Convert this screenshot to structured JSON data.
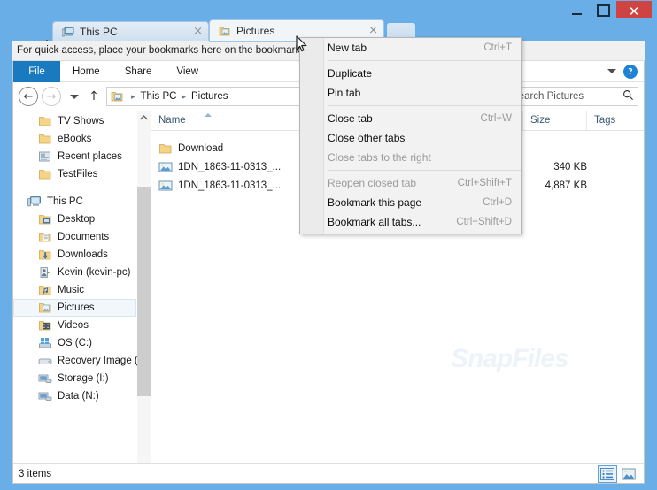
{
  "window": {
    "controls": {
      "minimize": "–",
      "maximize": "☐",
      "close": "✕"
    },
    "close_color": "#cf4343",
    "frame_color": "#6aaee8"
  },
  "tabs": {
    "items": [
      {
        "label": "This PC",
        "icon": "this-pc-icon",
        "close": "×",
        "active": false
      },
      {
        "label": "Pictures",
        "icon": "pictures-folder-icon",
        "close": "×",
        "active": true
      }
    ],
    "new_tab_button": "",
    "wrench_icon": "wrench-icon"
  },
  "bookmark_bar": {
    "text": "For quick access, place your bookmarks here on the bookmarks bar."
  },
  "ribbon": {
    "tabs": [
      {
        "label": "File",
        "accent": "#1a7ac0"
      },
      {
        "label": "Home"
      },
      {
        "label": "Share"
      },
      {
        "label": "View"
      }
    ],
    "expand_icon": "chevron-down-icon",
    "help_label": "?"
  },
  "address_bar": {
    "back": "←",
    "forward": "→",
    "history": "▼",
    "up": "↑",
    "folder_icon": "pictures-folder-icon",
    "crumbs": [
      "This PC",
      "Pictures"
    ],
    "separator": "▸"
  },
  "search": {
    "value": "Search Pictures",
    "placeholder": "Search Pictures",
    "icon": "search-icon"
  },
  "nav_pane": {
    "items": [
      {
        "label": "TV Shows",
        "icon": "folder-icon",
        "level": 1
      },
      {
        "label": "eBooks",
        "icon": "folder-icon",
        "level": 1
      },
      {
        "label": "Recent places",
        "icon": "recent-places-icon",
        "level": 1
      },
      {
        "label": "TestFiles",
        "icon": "folder-icon",
        "level": 1
      },
      {
        "label": "",
        "icon": "",
        "level": -1
      },
      {
        "label": "This PC",
        "icon": "this-pc-icon",
        "level": 0
      },
      {
        "label": "Desktop",
        "icon": "desktop-folder-icon",
        "level": 1
      },
      {
        "label": "Documents",
        "icon": "documents-folder-icon",
        "level": 1
      },
      {
        "label": "Downloads",
        "icon": "downloads-folder-icon",
        "level": 1
      },
      {
        "label": "Kevin (kevin-pc)",
        "icon": "user-folder-icon",
        "level": 1
      },
      {
        "label": "Music",
        "icon": "music-folder-icon",
        "level": 1
      },
      {
        "label": "Pictures",
        "icon": "pictures-folder-icon",
        "level": 1,
        "selected": true
      },
      {
        "label": "Videos",
        "icon": "videos-folder-icon",
        "level": 1
      },
      {
        "label": "OS (C:)",
        "icon": "os-drive-icon",
        "level": 1
      },
      {
        "label": "Recovery Image (",
        "icon": "drive-icon",
        "level": 1
      },
      {
        "label": "Storage (I:)",
        "icon": "network-drive-icon",
        "level": 1
      },
      {
        "label": "Data (N:)",
        "icon": "network-drive-icon",
        "level": 1
      }
    ],
    "scroll_up": "ⱏ",
    "scroll_down": "ⱟ"
  },
  "file_list": {
    "columns": [
      {
        "label": "Name",
        "sorted": true
      },
      {
        "label": "Size"
      },
      {
        "label": "Tags"
      }
    ],
    "rows": [
      {
        "name": "Download",
        "icon": "folder-icon",
        "size": ""
      },
      {
        "name": "1DN_1863-11-0313_...",
        "icon": "image-file-icon",
        "size": "340 KB"
      },
      {
        "name": "1DN_1863-11-0313_...",
        "icon": "image-file-icon",
        "size": "4,887 KB"
      }
    ],
    "hscroll_left": "‹",
    "hscroll_right": "›"
  },
  "context_menu": {
    "items": [
      {
        "label": "New tab",
        "accel": "Ctrl+T",
        "disabled": false
      },
      {
        "sep": true
      },
      {
        "label": "Duplicate",
        "accel": "",
        "disabled": false
      },
      {
        "label": "Pin tab",
        "accel": "",
        "disabled": false
      },
      {
        "sep": true
      },
      {
        "label": "Close tab",
        "accel": "Ctrl+W",
        "disabled": false
      },
      {
        "label": "Close other tabs",
        "accel": "",
        "disabled": false
      },
      {
        "label": "Close tabs to the right",
        "accel": "",
        "disabled": true
      },
      {
        "sep": true
      },
      {
        "label": "Reopen closed tab",
        "accel": "Ctrl+Shift+T",
        "disabled": true
      },
      {
        "label": "Bookmark this page",
        "accel": "Ctrl+D",
        "disabled": false
      },
      {
        "label": "Bookmark all tabs...",
        "accel": "Ctrl+Shift+D",
        "disabled": false
      }
    ]
  },
  "status_bar": {
    "item_count": "3 items",
    "views": [
      {
        "icon": "details-view-icon",
        "active": true
      },
      {
        "icon": "large-icons-view-icon",
        "active": false
      }
    ]
  },
  "watermark": {
    "text": "SnapFiles"
  }
}
